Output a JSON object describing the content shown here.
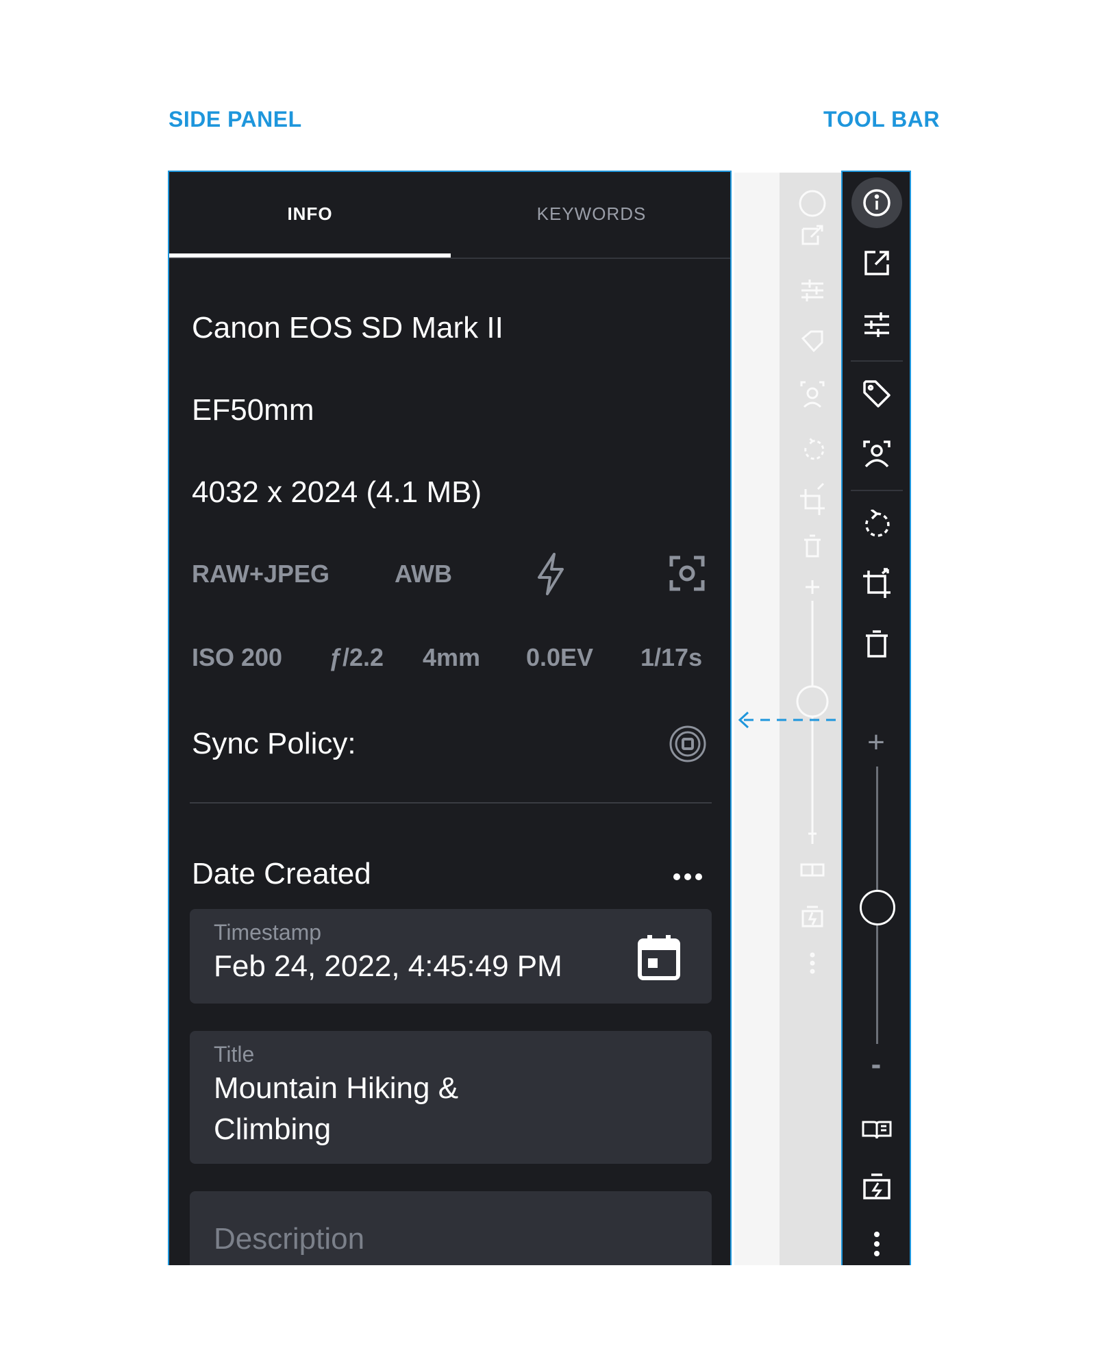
{
  "callouts": {
    "side_panel": "SIDE PANEL",
    "tool_bar": "TOOL BAR"
  },
  "tabs": [
    {
      "label": "INFO",
      "active": true
    },
    {
      "label": "KEYWORDS",
      "active": false
    }
  ],
  "info": {
    "camera": "Canon EOS SD Mark II",
    "lens": "EF50mm",
    "dimensions": "4032 x 2024 (4.1 MB)",
    "format": "RAW+JPEG",
    "white_balance": "AWB",
    "flash_icon": "flash-icon",
    "focus_icon": "focus-icon",
    "iso": "ISO 200",
    "aperture": "ƒ/2.2",
    "focal_length": "4mm",
    "exposure_comp": "0.0EV",
    "shutter": "1/17s",
    "sync_label": "Sync Policy:",
    "sync_icon": "sync-status-icon"
  },
  "date_section": {
    "title": "Date Created",
    "more_icon": "more-horizontal-icon",
    "timestamp_label": "Timestamp",
    "timestamp_value": "Feb 24, 2022, 4:45:49 PM"
  },
  "title_field": {
    "label": "Title",
    "value_line1": "Mountain Hiking &",
    "value_line2": "Climbing"
  },
  "description_field": {
    "placeholder": "Description"
  },
  "toolbar": {
    "icons": [
      "info-icon",
      "open-external-icon",
      "adjustments-icon",
      "tag-icon",
      "face-detect-icon",
      "rotate-icon",
      "crop-icon",
      "delete-icon",
      "zoom-in-icon",
      "zoom-out-icon",
      "book-icon",
      "battery-charge-icon",
      "more-vertical-icon"
    ],
    "zoom_plus": "+",
    "zoom_minus": "-",
    "zoom_level": 0.5
  },
  "colors": {
    "accent": "#1e96dc",
    "panel_bg": "#1b1c20",
    "field_bg": "#2f3138",
    "muted_text": "#8d929c"
  }
}
